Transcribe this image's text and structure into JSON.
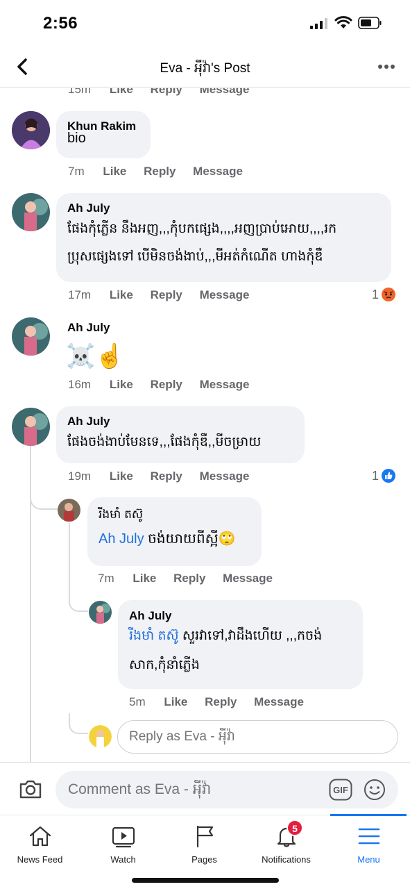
{
  "status": {
    "time": "2:56"
  },
  "header": {
    "title": "Eva - អុីវ៉ា's Post"
  },
  "comments": [
    {
      "time": "15m",
      "like": "Like",
      "reply": "Reply",
      "message": "Message"
    },
    {
      "author": "Khun Rakim",
      "text": "bio",
      "time": "7m",
      "like": "Like",
      "reply": "Reply",
      "message": "Message"
    },
    {
      "author": "Ah July",
      "line1": "ផែងកុំភ្លើន នឹងអញ,,,កុំបកផ្សេង,,,,អញប្រាប់អោយ,,,,រក",
      "line2": "ប្រុសផ្សេងទៅ បើមិនចង់ងាប់,,,មីអត់កំណើត ហាងកុំឌឺ",
      "time": "17m",
      "like": "Like",
      "reply": "Reply",
      "message": "Message",
      "reaction_count": "1"
    },
    {
      "author": "Ah July",
      "emoji": "☠️☝️",
      "time": "16m",
      "like": "Like",
      "reply": "Reply",
      "message": "Message"
    },
    {
      "author": "Ah July",
      "text": "ផែងចង់ងាប់មែនទេ,,,ផែងកុំឌឺ,,មីចម្រាយ",
      "time": "19m",
      "like": "Like",
      "reply": "Reply",
      "message": "Message",
      "reaction_count": "1"
    }
  ],
  "replies": [
    {
      "author": "រីងមាំ តស៊ូ",
      "mention": "Ah July",
      "text": " ចង់យាយពីស្អី🙄",
      "time": "7m",
      "like": "Like",
      "reply": "Reply",
      "message": "Message"
    },
    {
      "author": "Ah July",
      "mention": "រីងមាំ តស៊ូ",
      "line1": " សួរវាទៅ,វាដឹងហើយ ,,,កចង់",
      "line2": "សាក,កុំនាំភ្លើង",
      "time": "5m",
      "like": "Like",
      "reply": "Reply",
      "message": "Message"
    }
  ],
  "reply_input": {
    "placeholder": "Reply as Eva - អុីវ៉ា"
  },
  "comment_input": {
    "placeholder": "Comment as Eva - អុីវ៉ា"
  },
  "tabs": [
    {
      "label": "News Feed"
    },
    {
      "label": "Watch"
    },
    {
      "label": "Pages"
    },
    {
      "label": "Notifications",
      "badge": "5"
    },
    {
      "label": "Menu"
    }
  ],
  "colors": {
    "accent": "#1877f2",
    "badge": "#e41e3f",
    "bubble": "#f0f2f5",
    "mention": "#216fdb"
  }
}
